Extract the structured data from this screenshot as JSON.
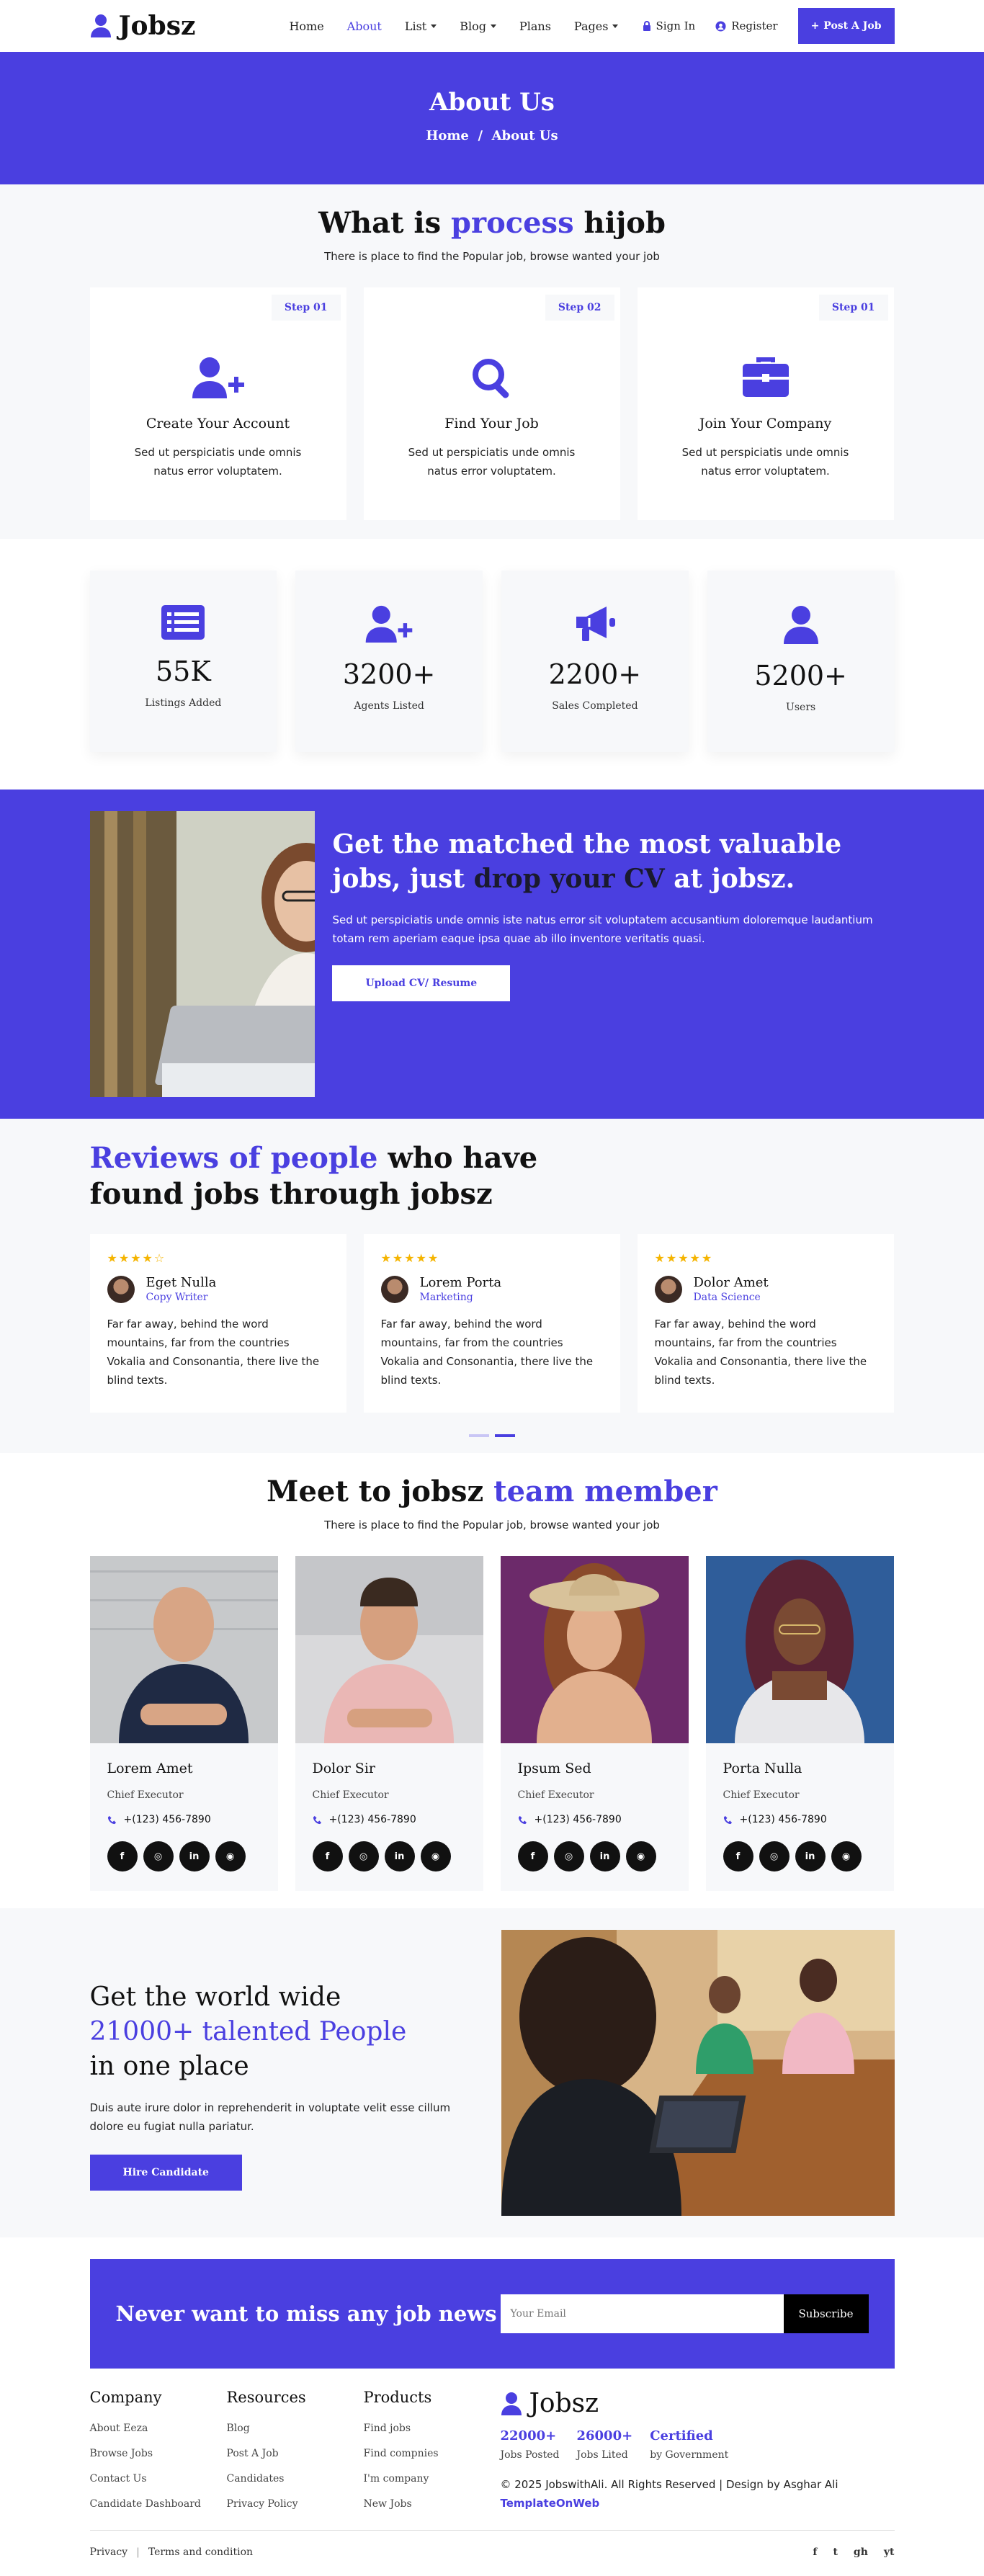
{
  "header": {
    "brand": "Jobsz",
    "nav": [
      {
        "label": "Home"
      },
      {
        "label": "About"
      },
      {
        "label": "List"
      },
      {
        "label": "Blog"
      },
      {
        "label": "Plans"
      },
      {
        "label": "Pages"
      }
    ],
    "sign_in": "Sign In",
    "register": "Register",
    "post_job": "Post A Job"
  },
  "banner": {
    "title": "About Us",
    "crumb_home": "Home",
    "crumb_sep": "/",
    "crumb_current": "About Us"
  },
  "process": {
    "title_pre": "What is ",
    "title_accent": "process",
    "title_post": " hijob",
    "subtitle": "There is place to find the Popular job, browse wanted your job",
    "steps": [
      {
        "tag": "Step 01",
        "title": "Create Your Account",
        "text": "Sed ut perspiciatis unde omnis natus error voluptatem.",
        "icon": "user-plus-icon"
      },
      {
        "tag": "Step 02",
        "title": "Find Your Job",
        "text": "Sed ut perspiciatis unde omnis natus error voluptatem.",
        "icon": "search-icon"
      },
      {
        "tag": "Step 01",
        "title": "Join Your Company",
        "text": "Sed ut perspiciatis unde omnis natus error voluptatem.",
        "icon": "briefcase-icon"
      }
    ]
  },
  "stats": [
    {
      "value": "55K",
      "label": "Listings Added",
      "icon": "list-icon"
    },
    {
      "value": "3200+",
      "label": "Agents Listed",
      "icon": "user-plus-icon"
    },
    {
      "value": "2200+",
      "label": "Sales Completed",
      "icon": "megaphone-icon"
    },
    {
      "value": "5200+",
      "label": "Users",
      "icon": "user-icon"
    }
  ],
  "cv": {
    "title_pre": "Get the matched the most valuable jobs, just ",
    "title_dark": "drop your CV",
    "title_post": " at jobsz.",
    "text": "Sed ut perspiciatis unde omnis iste natus error sit voluptatem accusantium doloremque laudantium totam rem aperiam eaque ipsa quae ab illo inventore veritatis quasi.",
    "button": "Upload CV/ Resume"
  },
  "reviews": {
    "title_accent": "Reviews of people",
    "title_post": " who have",
    "title_line2": "found jobs through jobsz",
    "items": [
      {
        "stars": "★★★★☆",
        "rating": 4,
        "name": "Eget Nulla",
        "role": "Copy Writer",
        "text": "Far far away, behind the word mountains, far from the countries Vokalia and Consonantia, there live the blind texts."
      },
      {
        "stars": "★★★★★",
        "rating": 4.5,
        "name": "Lorem Porta",
        "role": "Marketing",
        "text": "Far far away, behind the word mountains, far from the countries Vokalia and Consonantia, there live the blind texts."
      },
      {
        "stars": "★★★★★",
        "rating": 5,
        "name": "Dolor Amet",
        "role": "Data Science",
        "text": "Far far away, behind the word mountains, far from the countries Vokalia and Consonantia, there live the blind texts."
      }
    ]
  },
  "team": {
    "title_pre": "Meet to jobsz ",
    "title_accent": "team member",
    "subtitle": "There is place to find the Popular job, browse wanted your job",
    "members": [
      {
        "name": "Lorem Amet",
        "role": "Chief Executor",
        "phone": "+(123) 456-7890"
      },
      {
        "name": "Dolor Sir",
        "role": "Chief Executor",
        "phone": "+(123) 456-7890"
      },
      {
        "name": "Ipsum Sed",
        "role": "Chief Executor",
        "phone": "+(123) 456-7890"
      },
      {
        "name": "Porta Nulla",
        "role": "Chief Executor",
        "phone": "+(123) 456-7890"
      }
    ],
    "social_icons": [
      "f",
      "◎",
      "in",
      "◉"
    ]
  },
  "talent": {
    "line1": "Get the world wide",
    "line2": "21000+ talented People",
    "line3": "in one place",
    "text": "Duis aute irure dolor in reprehenderit in voluptate velit esse cillum dolore eu fugiat nulla pariatur.",
    "button": "Hire Candidate"
  },
  "newsletter": {
    "title": "Never want to miss any job news",
    "placeholder": "Your Email",
    "button": "Subscribe"
  },
  "footer": {
    "columns": [
      {
        "title": "Company",
        "links": [
          "About Eeza",
          "Browse Jobs",
          "Contact Us",
          "Candidate Dashboard"
        ]
      },
      {
        "title": "Resources",
        "links": [
          "Blog",
          "Post A Job",
          "Candidates",
          "Privacy Policy"
        ]
      },
      {
        "title": "Products",
        "links": [
          "Find jobs",
          "Find compnies",
          "I'm company",
          "New Jobs"
        ]
      }
    ],
    "brand": "Jobsz",
    "stats": [
      {
        "value": "22000+",
        "label": "Jobs Posted"
      },
      {
        "value": "26000+",
        "label": "Jobs Lited"
      },
      {
        "value": "Certified",
        "label": "by Government"
      }
    ],
    "copyright": "© 2025 JobswithAli. All Rights Reserved | Design by Asghar Ali",
    "copyright_link": "TemplateOnWeb",
    "bottom_links": [
      "Privacy",
      "Terms and condition"
    ],
    "social": [
      "f",
      "t",
      "gh",
      "yt"
    ]
  },
  "colors": {
    "accent": "#4a3fe0",
    "surface": "#f7f8fa"
  }
}
